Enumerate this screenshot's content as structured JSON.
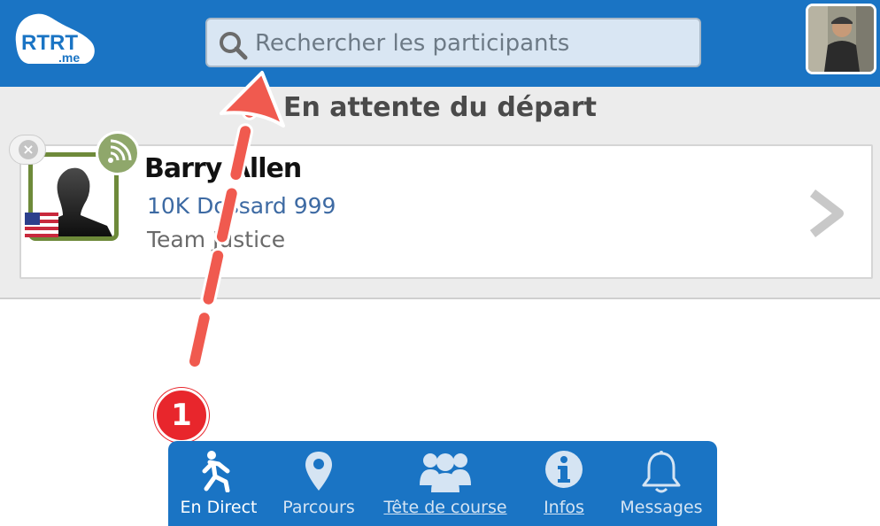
{
  "header": {
    "logo_text": "RTRT",
    "logo_sub": ".me",
    "search_placeholder": "Rechercher les participants",
    "search_value": ""
  },
  "status": {
    "title": "En attente du départ"
  },
  "participant": {
    "name": "Barry Allen",
    "race": "10K Dossard 999",
    "team": "Team Justice",
    "flag": "us-flag-icon"
  },
  "annotation": {
    "step_number": "1"
  },
  "nav": {
    "items": [
      {
        "label": "En Direct",
        "icon": "runner-icon"
      },
      {
        "label": "Parcours",
        "icon": "map-pin-icon"
      },
      {
        "label": "Tête de course",
        "icon": "group-icon"
      },
      {
        "label": "Infos",
        "icon": "info-icon"
      },
      {
        "label": "Messages",
        "icon": "bell-icon"
      }
    ]
  },
  "colors": {
    "brand_blue": "#1a74c4",
    "arrow_red": "#f05a4f",
    "photo_border": "#6e8a3a"
  }
}
